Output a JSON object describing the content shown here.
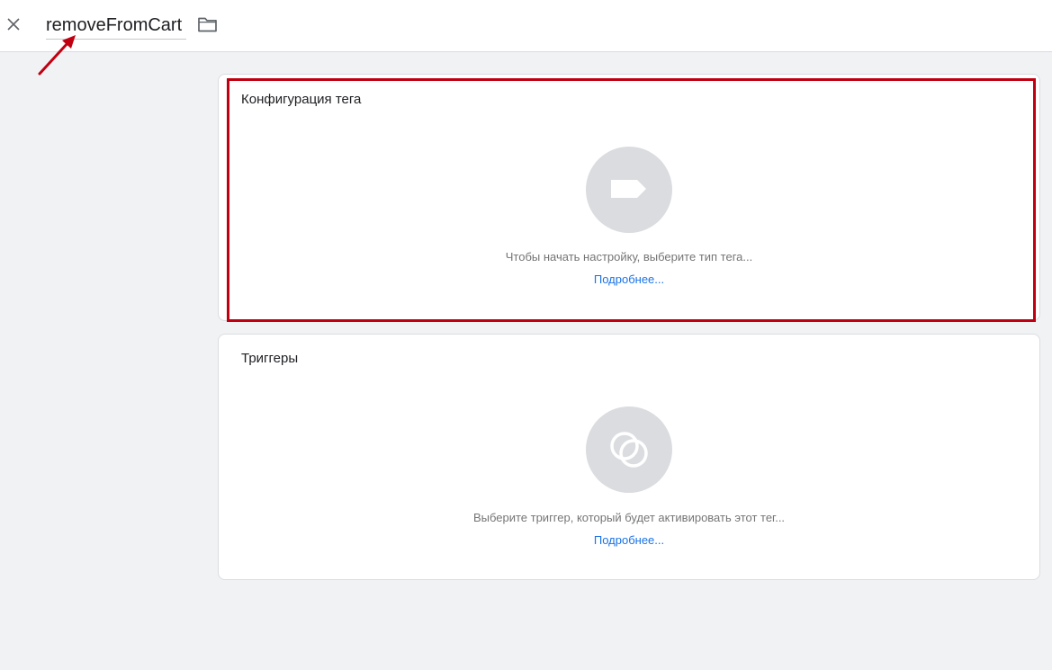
{
  "header": {
    "tag_name": "removeFromCart",
    "close_icon": "close-icon",
    "folder_icon": "folder-icon"
  },
  "tag_config": {
    "title": "Конфигурация тега",
    "icon": "tag-icon",
    "hint": "Чтобы начать настройку, выберите тип тега...",
    "more_link": "Подробнее...",
    "highlight_color": "#c00010"
  },
  "triggers": {
    "title": "Триггеры",
    "icon": "trigger-icon",
    "hint": "Выберите триггер, который будет активировать этот тег...",
    "more_link": "Подробнее..."
  },
  "colors": {
    "background": "#f1f2f4",
    "card": "#ffffff",
    "icon_circle": "#dadce0",
    "link": "#1a73e8",
    "annotation_arrow": "#c00010"
  }
}
